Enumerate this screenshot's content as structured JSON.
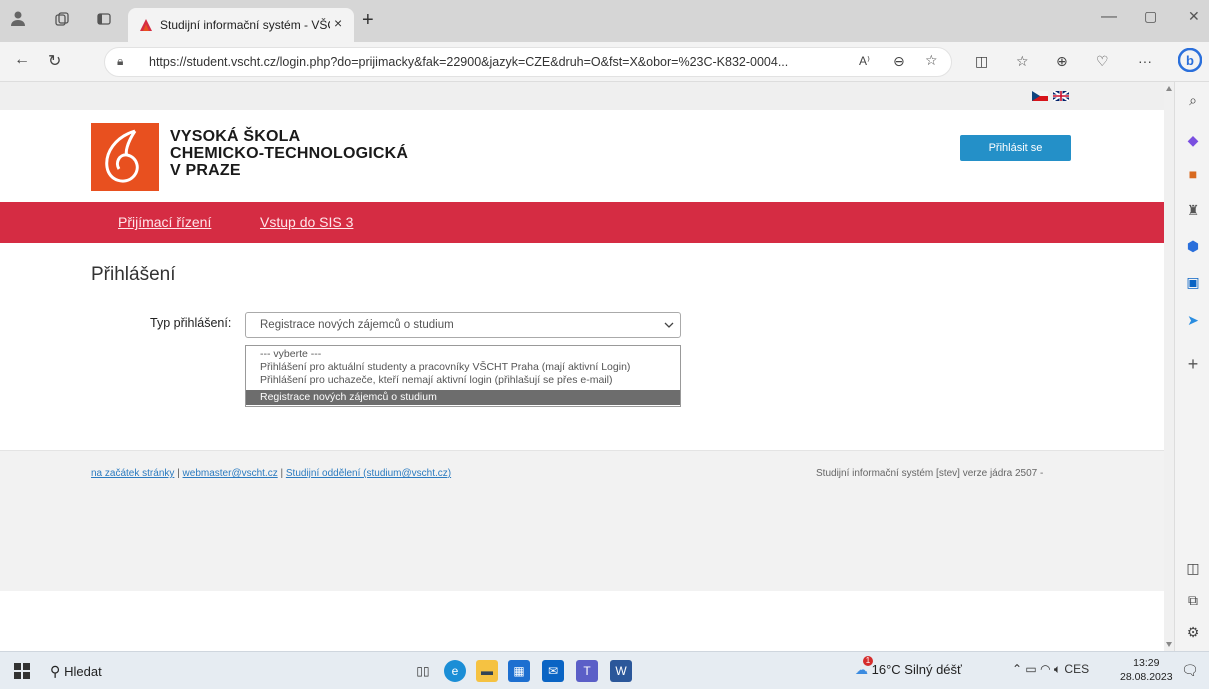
{
  "browser": {
    "tab_title": "Studijní informační systém - VŠC",
    "tab_close": "×",
    "new_tab": "+",
    "url": "https://student.vscht.cz/login.php?do=prijimacky&fak=22900&jazyk=CZE&druh=O&fst=X&obor=%23C-K832-0004...",
    "read_aloud": "A⁾",
    "more": "···",
    "window_minimize": "—",
    "window_restore": "▢",
    "window_close": "✕"
  },
  "header": {
    "school_line1": "VYSOKÁ ŠKOLA",
    "school_line2": "CHEMICKO-TECHNOLOGICKÁ",
    "school_line3": "V PRAZE",
    "login_button": "Přihlásit se",
    "brand_color": "#e8501f",
    "nav_color": "#d52c43"
  },
  "nav": {
    "items": [
      {
        "label": "Přijímací řízení"
      },
      {
        "label": "Vstup do SIS 3"
      }
    ]
  },
  "main": {
    "heading": "Přihlášení",
    "type_label": "Typ přihlášení:",
    "select_value": "Registrace nových zájemců o studium",
    "options": [
      "--- vyberte ---",
      "Přihlášení pro aktuální studenty a pracovníky VŠCHT Praha (mají aktivní Login)",
      "Přihlášení pro uchazeče, kteří nemají aktivní login (přihlašují se přes e-mail)",
      "Registrace nových zájemců o studium"
    ]
  },
  "footer": {
    "link1": "na začátek stránky",
    "sep": " | ",
    "link2": "webmaster@vscht.cz",
    "link3": "Studijní oddělení (studium@vscht.cz)",
    "info": "Studijní informační systém [stev] verze jádra 2507 -"
  },
  "taskbar": {
    "search": "Hledat",
    "weather": "16°C  Silný déšť",
    "lang": "CES",
    "time": "13:29",
    "date": "28.08.2023",
    "weather_badge": "1"
  }
}
